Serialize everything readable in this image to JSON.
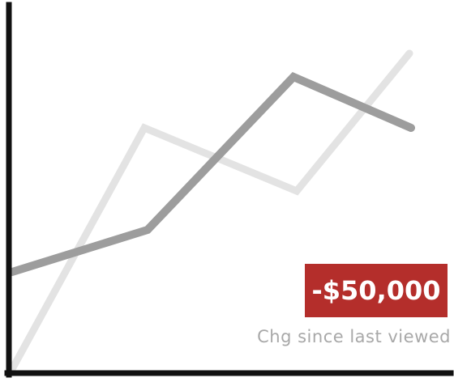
{
  "chart_data": {
    "type": "line",
    "x": [
      0,
      1,
      2,
      3,
      4
    ],
    "series": [
      {
        "values": [
          0,
          7.4,
          5.9,
          10
        ]
      },
      {
        "values": [
          3.0,
          4.1,
          8.6,
          7.3
        ]
      }
    ],
    "colors": {
      "series_light": "#e3e3e3",
      "series_dark": "#9d9d9d",
      "axis": "#111111"
    },
    "grid": false,
    "legend": "none"
  },
  "annotation": {
    "value": "-$50,000",
    "caption": "Chg since last viewed",
    "badge_color": "#b42e2b"
  }
}
